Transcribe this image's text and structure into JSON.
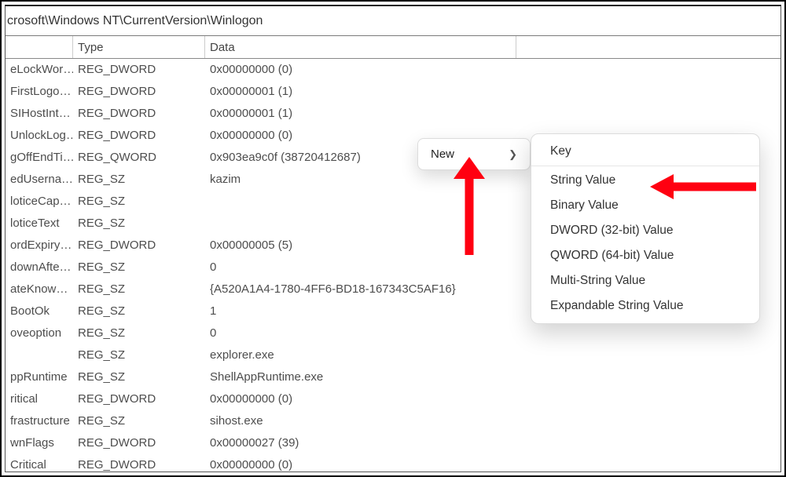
{
  "address_path": "crosoft\\Windows NT\\CurrentVersion\\Winlogon",
  "columns": {
    "name": "",
    "type": "Type",
    "data": "Data"
  },
  "rows": [
    {
      "name": "eLockWor…",
      "type": "REG_DWORD",
      "data": "0x00000000 (0)"
    },
    {
      "name": "FirstLogo…",
      "type": "REG_DWORD",
      "data": "0x00000001 (1)"
    },
    {
      "name": "SIHostInt…",
      "type": "REG_DWORD",
      "data": "0x00000001 (1)"
    },
    {
      "name": "UnlockLog…",
      "type": "REG_DWORD",
      "data": "0x00000000 (0)"
    },
    {
      "name": "gOffEndTi…",
      "type": "REG_QWORD",
      "data": "0x903ea9c0f (38720412687)"
    },
    {
      "name": "edUserna…",
      "type": "REG_SZ",
      "data": "kazim"
    },
    {
      "name": "loticeCap…",
      "type": "REG_SZ",
      "data": ""
    },
    {
      "name": "loticeText",
      "type": "REG_SZ",
      "data": ""
    },
    {
      "name": "ordExpiry…",
      "type": "REG_DWORD",
      "data": "0x00000005 (5)"
    },
    {
      "name": "downAfte…",
      "type": "REG_SZ",
      "data": "0"
    },
    {
      "name": "ateKnow…",
      "type": "REG_SZ",
      "data": "{A520A1A4-1780-4FF6-BD18-167343C5AF16}"
    },
    {
      "name": "BootOk",
      "type": "REG_SZ",
      "data": "1"
    },
    {
      "name": "oveoption",
      "type": "REG_SZ",
      "data": "0"
    },
    {
      "name": "",
      "type": "REG_SZ",
      "data": "explorer.exe"
    },
    {
      "name": "ppRuntime",
      "type": "REG_SZ",
      "data": "ShellAppRuntime.exe"
    },
    {
      "name": "ritical",
      "type": "REG_DWORD",
      "data": "0x00000000 (0)"
    },
    {
      "name": "frastructure",
      "type": "REG_SZ",
      "data": "sihost.exe"
    },
    {
      "name": "wnFlags",
      "type": "REG_DWORD",
      "data": "0x00000027 (39)"
    },
    {
      "name": "Critical",
      "type": "REG_DWORD",
      "data": "0x00000000 (0)"
    }
  ],
  "ctx1": {
    "new_label": "New"
  },
  "ctx2": {
    "key": "Key",
    "string": "String Value",
    "binary": "Binary Value",
    "dword": "DWORD (32-bit) Value",
    "qword": "QWORD (64-bit) Value",
    "multi": "Multi-String Value",
    "expand": "Expandable String Value"
  }
}
